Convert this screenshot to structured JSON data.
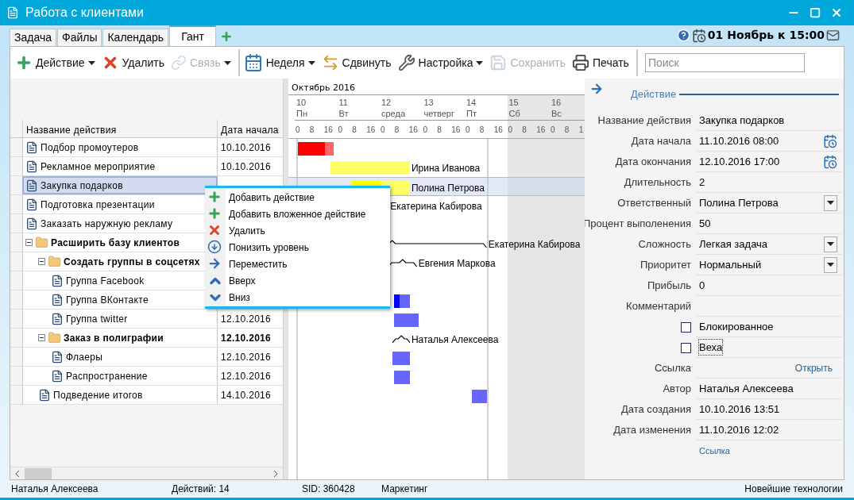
{
  "window": {
    "title": "Работа с клиентами"
  },
  "tabs": [
    {
      "label": "Задача",
      "selected": false
    },
    {
      "label": "Файлы",
      "selected": false
    },
    {
      "label": "Календарь",
      "selected": false
    },
    {
      "label": "Гант",
      "selected": true
    }
  ],
  "reminder": {
    "text": "01 Ноябрь к 15:00"
  },
  "toolbar": [
    {
      "kind": "button",
      "label": "Действие",
      "dropdown": true,
      "disabled": false
    },
    {
      "kind": "button",
      "label": "Удалить",
      "dropdown": false,
      "disabled": false
    },
    {
      "kind": "button",
      "label": "Связь",
      "dropdown": true,
      "disabled": true
    },
    {
      "kind": "separator"
    },
    {
      "kind": "button",
      "label": "Неделя",
      "dropdown": true,
      "disabled": false
    },
    {
      "kind": "button",
      "label": "Сдвинуть",
      "dropdown": false,
      "disabled": false
    },
    {
      "kind": "button",
      "label": "Настройка",
      "dropdown": true,
      "disabled": false
    },
    {
      "kind": "button",
      "label": "Сохранить",
      "dropdown": false,
      "disabled": true
    },
    {
      "kind": "button",
      "label": "Печать",
      "dropdown": false,
      "disabled": false
    },
    {
      "kind": "separator"
    }
  ],
  "search": {
    "placeholder": "Поиск"
  },
  "tree": {
    "columns": [
      "Название действия",
      "Дата начала"
    ],
    "items": [
      {
        "kind": "task",
        "name": "Подбор промоутеров",
        "date": "10.10.2016",
        "selected": false,
        "bar": {
          "kind": "task",
          "level": 0.75,
          "color": "#ff6666"
        }
      },
      {
        "kind": "task",
        "name": "Рекламное мероприятие",
        "date": "10.10.2016",
        "selected": false,
        "bar": {
          "kind": "task",
          "color": "#ffff66",
          "assignee": "Ирина Иванова"
        }
      },
      {
        "kind": "task",
        "name": "Закупка подарков",
        "selected": true,
        "bar": {
          "kind": "task",
          "level": 0.5,
          "color": "#ffff66",
          "assignee": "Полина Петрова"
        }
      },
      {
        "kind": "task",
        "name": "Подготовка презентации",
        "selected": false,
        "bar": {
          "kind": "task",
          "assignee": "Екатерина Кабирова"
        }
      },
      {
        "kind": "task",
        "name": "Заказать наружную рекламу",
        "selected": false
      },
      {
        "kind": "group",
        "name": "Расширить базу клиентов",
        "selected": false,
        "expanded": true,
        "bar": {
          "kind": "summary",
          "assignee": "Екатерина Кабирова"
        },
        "children": [
          {
            "kind": "group",
            "name": "Создать группы в соцсетях",
            "selected": false,
            "expanded": true,
            "bar": {
              "kind": "summary",
              "assignee": "Евгения Маркова"
            },
            "children": [
              {
                "kind": "task",
                "name": "Группа Facebook",
                "selected": false
              },
              {
                "kind": "task",
                "name": "Группа ВКонтакте",
                "selected": false,
                "bar": {
                  "kind": "task",
                  "level": 0.35,
                  "color": "#6666ff"
                }
              },
              {
                "kind": "task",
                "name": "Группа twitter",
                "date": "12.10.2016",
                "selected": false,
                "bar": {
                  "kind": "task",
                  "color": "#6666ff"
                }
              }
            ]
          },
          {
            "kind": "group",
            "name": "Заказ в полиграфии",
            "date": "12.10.2016",
            "selected": false,
            "expanded": true,
            "bar": {
              "kind": "summary",
              "assignee": "Наталья Алексеева"
            },
            "children": [
              {
                "kind": "task",
                "name": "Флаеры",
                "date": "12.10.2016",
                "selected": false,
                "bar": {
                  "kind": "task",
                  "color": "#6666ff"
                }
              },
              {
                "kind": "task",
                "name": "Распространение",
                "date": "12.10.2016",
                "selected": false,
                "bar": {
                  "kind": "task",
                  "color": "#6666ff"
                }
              }
            ]
          },
          {
            "kind": "task",
            "name": "Подведение итогов",
            "date": "14.10.2016",
            "selected": false,
            "bar": {
              "kind": "task",
              "color": "#6666ff"
            }
          }
        ]
      }
    ]
  },
  "gantt": {
    "month": "Октябрь 2016",
    "days": [
      {
        "number": "10",
        "name": "Пн",
        "weekend": false,
        "hours": [
          "0",
          "8",
          "16"
        ]
      },
      {
        "number": "11",
        "name": "Вт",
        "weekend": false,
        "hours": [
          "0",
          "8",
          "16"
        ]
      },
      {
        "number": "12",
        "name": "среда",
        "weekend": false,
        "hours": [
          "0",
          "8",
          "16"
        ]
      },
      {
        "number": "13",
        "name": "четверг",
        "weekend": false,
        "hours": [
          "0",
          "8",
          "16"
        ]
      },
      {
        "number": "14",
        "name": "Пт",
        "weekend": false,
        "hours": [
          "0",
          "8",
          "16"
        ]
      },
      {
        "number": "15",
        "name": "Сб",
        "weekend": true,
        "hours": [
          "0",
          "8",
          "16"
        ]
      },
      {
        "number": "16",
        "name": "Вс",
        "weekend": true,
        "hours": [
          "0",
          "8",
          "1"
        ]
      }
    ]
  },
  "context_menu": [
    "Добавить действие",
    "Добавить вложенное действие",
    "Удалить",
    "Понизить уровень",
    "Переместить",
    "Вверх",
    "Вниз"
  ],
  "details": {
    "title": "Действие",
    "fields": [
      {
        "kind": "text",
        "label": "Название действия",
        "value": "Закупка подарков"
      },
      {
        "kind": "date",
        "label": "Дата начала",
        "value": "11.10.2016 08:00"
      },
      {
        "kind": "date",
        "label": "Дата окончания",
        "value": "12.10.2016 17:00"
      },
      {
        "kind": "text",
        "label": "Длительность",
        "value": "2"
      },
      {
        "kind": "select",
        "label": "Ответственный",
        "value": "Полина Петрова"
      },
      {
        "kind": "text",
        "label": "Процент выполенения",
        "value": "50"
      },
      {
        "kind": "select",
        "label": "Сложность",
        "value": "Легкая задача"
      },
      {
        "kind": "select",
        "label": "Приоритет",
        "value": "Нормальный"
      },
      {
        "kind": "text",
        "label": "Прибыль",
        "value": "0"
      },
      {
        "kind": "text",
        "label": "Комментарий"
      },
      {
        "kind": "checkbox",
        "label": "Блокированное",
        "checked": false,
        "focused": false
      },
      {
        "kind": "checkbox",
        "label": "Веха",
        "checked": false,
        "focused": true
      },
      {
        "kind": "link",
        "label": "Ссылка",
        "value": "Открыть"
      },
      {
        "kind": "text",
        "label": "Автор",
        "value": "Наталья Алексеева"
      },
      {
        "kind": "text",
        "label": "Дата создания",
        "value": "10.10.2016 13:51"
      },
      {
        "kind": "text",
        "label": "Дата изменения",
        "value": "11.10.2016 12:02"
      },
      {
        "kind": "footer_link",
        "value": "Ссылка"
      }
    ]
  },
  "status_bar": [
    "Наталья Алексеева",
    "Действий: 14",
    "SID: 360428",
    "Маркетинг",
    "Новейшие технологии"
  ]
}
